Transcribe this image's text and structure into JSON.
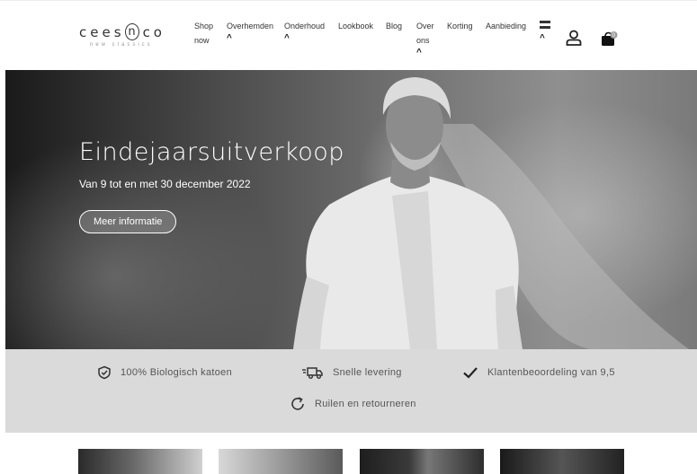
{
  "header": {
    "logo": {
      "word_left": "cees",
      "word_mid": "n",
      "word_right": "co",
      "tagline": "new classics"
    },
    "nav": [
      {
        "label_1": "Shop",
        "label_2": "now",
        "has_chevron": false
      },
      {
        "label_1": "Overhemden",
        "label_2": "",
        "has_chevron": true
      },
      {
        "label_1": "Onderhoud",
        "label_2": "",
        "has_chevron": true
      },
      {
        "label_1": "Lookbook",
        "label_2": "",
        "has_chevron": false
      },
      {
        "label_1": "Blog",
        "label_2": "",
        "has_chevron": false
      },
      {
        "label_1": "Over",
        "label_2": "ons",
        "has_chevron": true
      },
      {
        "label_1": "Korting",
        "label_2": "",
        "has_chevron": false
      },
      {
        "label_1": "Aanbieding",
        "label_2": "",
        "has_chevron": false
      }
    ],
    "chevron_glyph": "^",
    "icons": [
      "menu-icon",
      "user-icon",
      "cart-icon"
    ],
    "cart_count": "0"
  },
  "hero": {
    "title": "Eindejaarsuitverkoop",
    "subtitle": "Van 9 tot en met 30 december 2022",
    "button_label": "Meer informatie"
  },
  "usps": [
    {
      "icon": "shield-check-icon",
      "label": "100% Biologisch katoen"
    },
    {
      "icon": "delivery-truck-icon",
      "label": "Snelle levering"
    },
    {
      "icon": "checkmark-icon",
      "label": "Klantenbeoordeling van 9,5"
    },
    {
      "icon": "return-arrow-icon",
      "label": "Ruilen en retourneren"
    }
  ],
  "colors": {
    "usp_band": "#dadada",
    "text": "#333333",
    "hero_text": "#ffffff"
  }
}
